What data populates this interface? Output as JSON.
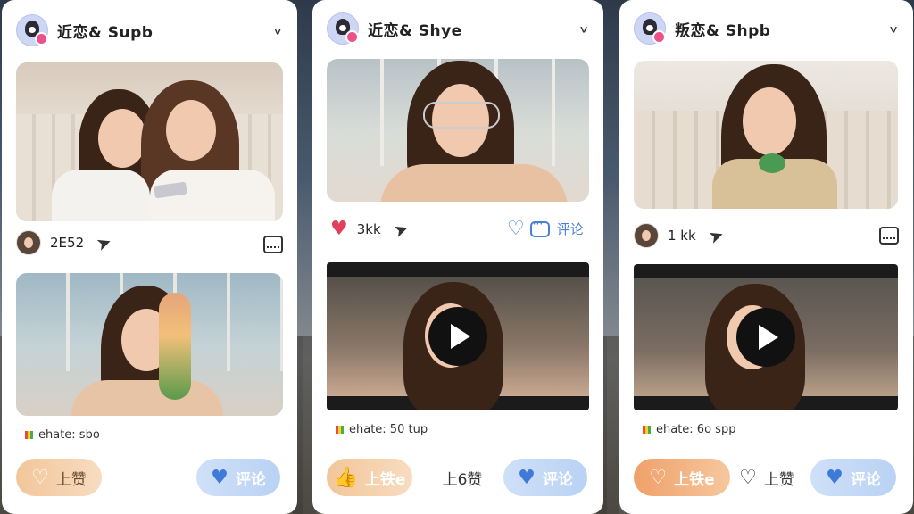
{
  "posts": [
    {
      "username": "近恋& Supb",
      "stat": "2E52",
      "status": "ehate: sbo",
      "buttons": {
        "like": "上赞",
        "comment": "评论"
      }
    },
    {
      "username": "近恋& Shye",
      "stat": "3kk",
      "comment_label": "评论",
      "status": "ehate: 50 tup",
      "buttons": {
        "like": "上铁e",
        "mid": "上6赞",
        "comment": "评论"
      }
    },
    {
      "username": "叛恋& Shpb",
      "stat": "1 kk",
      "status": "ehate: 6o spp",
      "buttons": {
        "like": "上铁e",
        "mid": "上赞",
        "comment": "评论"
      }
    }
  ],
  "icons": {
    "chevron": "chevron-down-icon",
    "share": "send-icon",
    "heart": "heart-icon",
    "comment": "comment-icon",
    "film": "film-icon",
    "play": "play-icon"
  },
  "colors": {
    "like_accent": "#f0a06a",
    "comment_accent": "#4a80d8",
    "heart_red": "#e0405a"
  }
}
